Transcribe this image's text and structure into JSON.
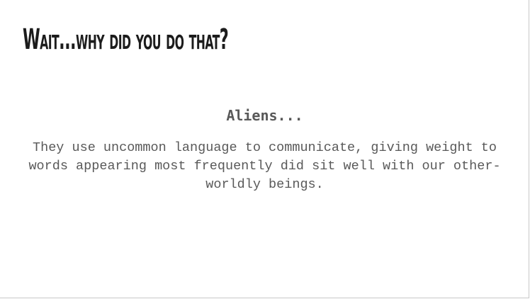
{
  "slide": {
    "title": "Wait...why did you do that?",
    "subheading": "Aliens...",
    "body": "They use uncommon language to communicate, giving weight to words appearing most frequently did sit well with our other-worldly beings."
  }
}
